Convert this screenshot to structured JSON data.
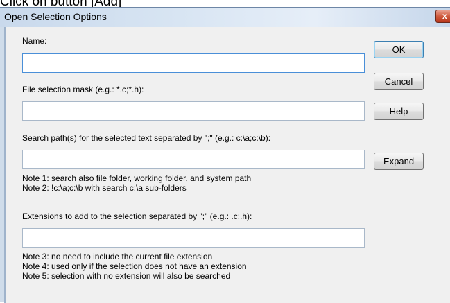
{
  "caption": "Click on button [Add]",
  "dialog": {
    "title": "Open Selection Options",
    "close_glyph": "x",
    "name_label": "Name:",
    "name_value": "",
    "mask_label": "File selection mask (e.g.: *.c;*.h):",
    "mask_value": "",
    "search_label": "Search path(s) for the selected text separated by \";\" (e.g.: c:\\a;c:\\b):",
    "search_value": "",
    "note1": "Note 1: search also file folder, working folder, and system path",
    "note2": "Note 2: !c:\\a;c:\\b with search c:\\a sub-folders",
    "ext_label": "Extensions to add to the selection separated by \";\" (e.g.: .c;.h):",
    "ext_value": "",
    "note3": "Note 3: no need to include the current file extension",
    "note4": "Note 4: used only if the selection does not have an extension",
    "note5": "Note 5: selection with no extension will also be searched"
  },
  "buttons": {
    "ok": "OK",
    "cancel": "Cancel",
    "help": "Help",
    "expand": "Expand"
  },
  "colors": {
    "accent": "#3c7fb1",
    "close": "#c8432a"
  }
}
